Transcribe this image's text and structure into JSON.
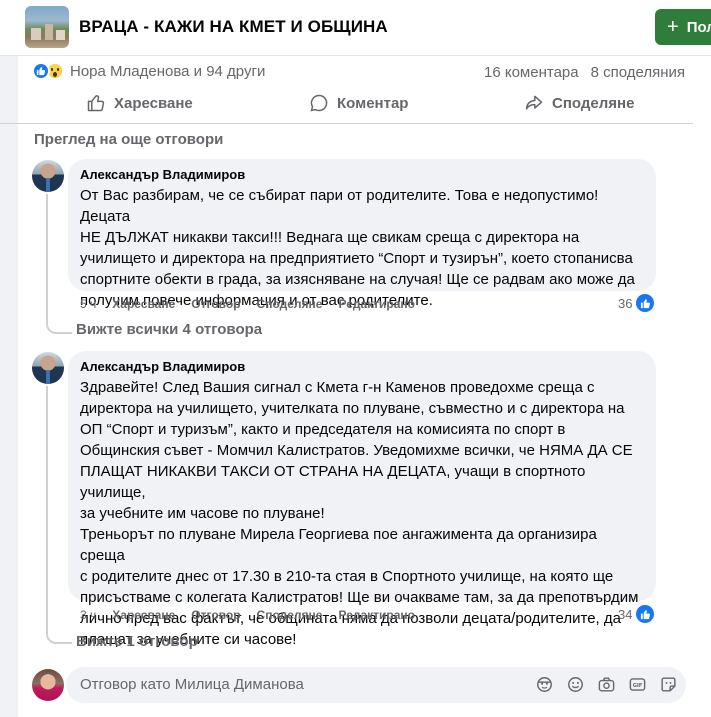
{
  "header": {
    "group_title": "ВРАЦА - КАЖИ НА КМЕТ И ОБЩИНА",
    "join_label": "Пол"
  },
  "post": {
    "reactions_text": "Нора Младенова и 94 други",
    "comments_count": "16 коментара",
    "shares_count": "8 споделяния",
    "actions": {
      "like": "Харесване",
      "comment": "Коментар",
      "share": "Споделяне"
    },
    "more_replies": "Преглед на още отговори"
  },
  "comments": [
    {
      "author": "Александър Владимиров",
      "text": "От Вас разбирам, че се събират пари от родителите. Това е недопустимо! Децата\nНЕ ДЪЛЖАТ никакви такси!!! Веднага ще свикам среща с директора на\nучилището и директора на предприятието “Спорт и тузирън”, което стопанисва\nспортните обекти в града, за изясняване на случая! Ще се радвам ако може да\nполучим повече информация и от вас родителите.",
      "time": "5 ч",
      "like": "Харесване",
      "reply": "Отговор",
      "share": "Споделяне",
      "edited": "Редактирано",
      "reaction_count": "36",
      "view_replies": "Вижте всички 4 отговора"
    },
    {
      "author": "Александър Владимиров",
      "text": "Здравейте! След Вашия сигнал с Кмета г-н Каменов проведохме среща с\nдиректора на училището, учителката по плуване, съвместно и с директора на\nОП “Спорт и туризъм”, както и председателя на комисията по спорт в\nОбщинския съвет - Момчил Калистратов. Уведомихме всички, че НЯМА ДА СЕ\nПЛАЩАТ НИКАКВИ ТАКСИ ОТ СТРАНА НА ДЕЦАТА, учащи в спортното училище,\nза учебните им часове по плуване!\nТреньорът по плуване Мирела Георгиева пое ангажимента да организира среща\nс родителите днес от 17.30 в 210-та стая в Спортното училище, на която ще\nприсъстваме с колегата Калистратов! Ще ви очакваме там, за да препотвърдим\nлично пред вас фактът, че общината няма да позволи децата/родителите, да\nплащат за учебните си часове!",
      "time": "3 ч",
      "like": "Харесване",
      "reply": "Отговор",
      "share": "Споделяне",
      "edited": "Редактирано",
      "reaction_count": "34",
      "view_replies": "Вижте 1 отговор"
    }
  ],
  "reply_box": {
    "placeholder": "Отговор като Милица Диманова"
  },
  "colors": {
    "accent": "#1877f2",
    "join_button": "#2e7d3a",
    "bubble": "#f0f2f5",
    "muted_text": "#65676b"
  },
  "icons": [
    "like-icon",
    "wow-icon",
    "comment-icon",
    "share-icon",
    "avatar-sticker-icon",
    "emoji-icon",
    "camera-icon",
    "gif-icon",
    "sticker-icon"
  ]
}
